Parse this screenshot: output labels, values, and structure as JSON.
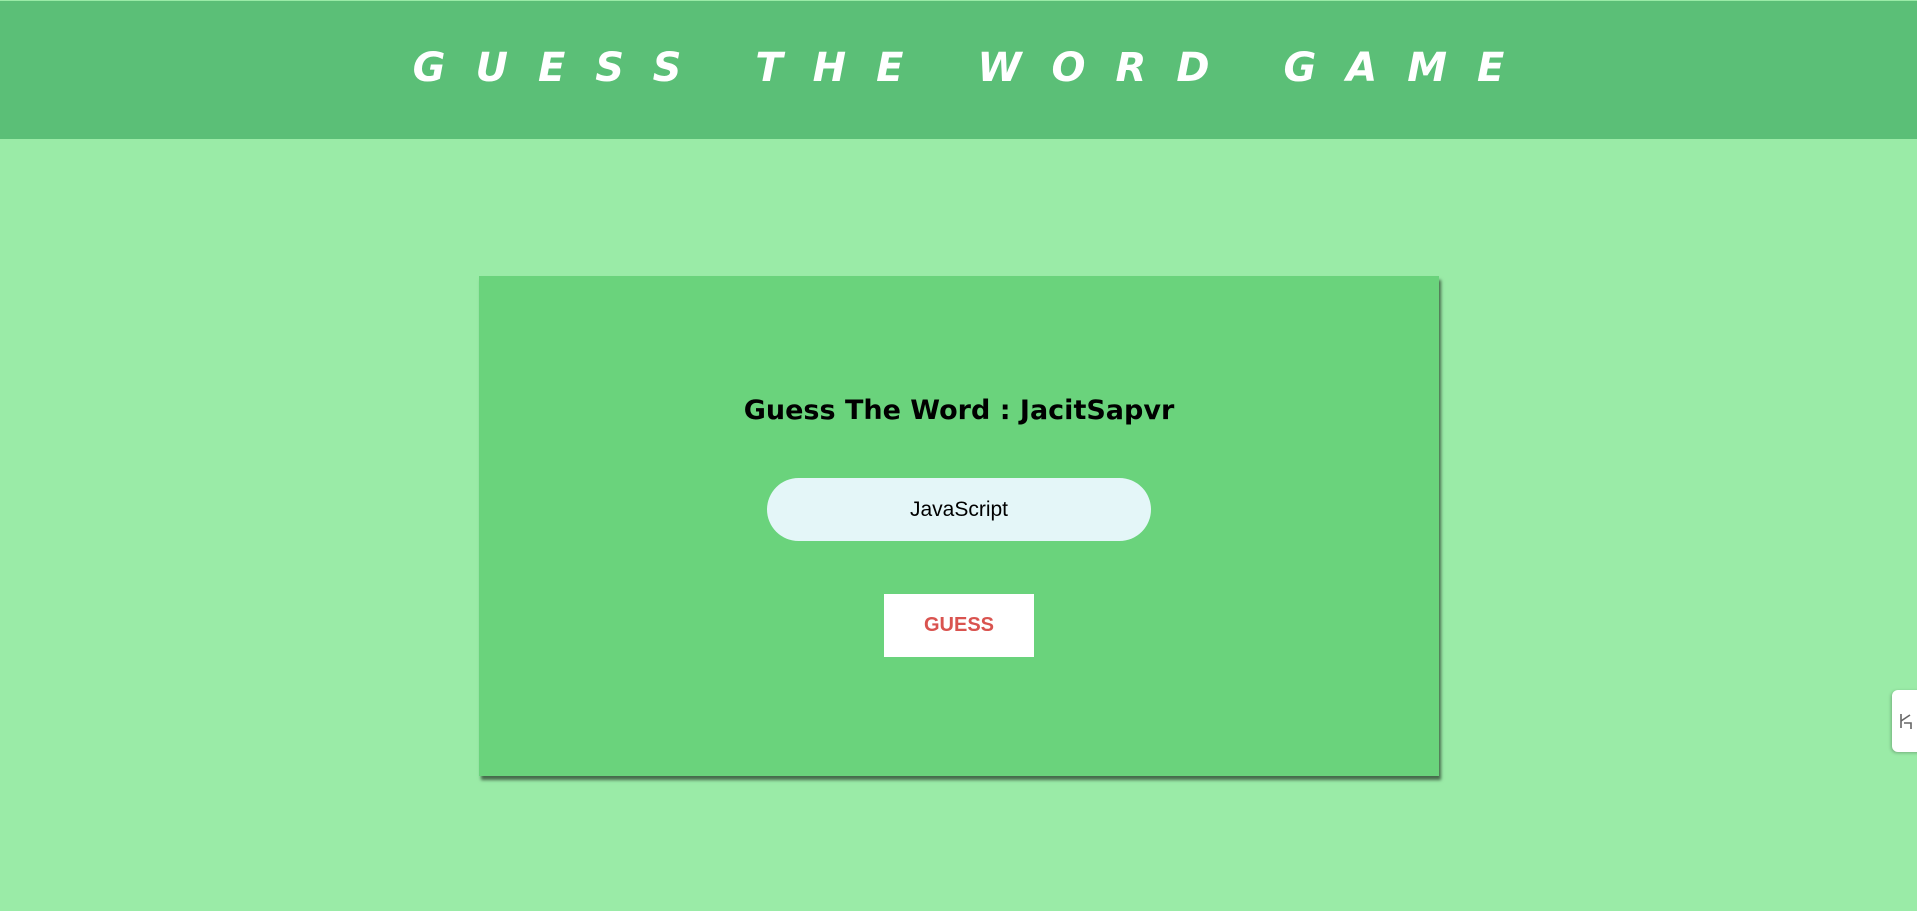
{
  "header": {
    "title": "GUESS THE WORD GAME"
  },
  "game": {
    "prompt_label": "Guess The Word : JacitSapvr",
    "input_value": "JavaScript",
    "guess_button_label": "GUESS"
  },
  "side_tab": {
    "icon": "translate-icon"
  },
  "colors": {
    "page_background": "#9aeba7",
    "header_background": "#5bbf77",
    "card_background": "#6ad37c",
    "input_background": "#e4f6f8",
    "button_text": "#d9534f"
  }
}
